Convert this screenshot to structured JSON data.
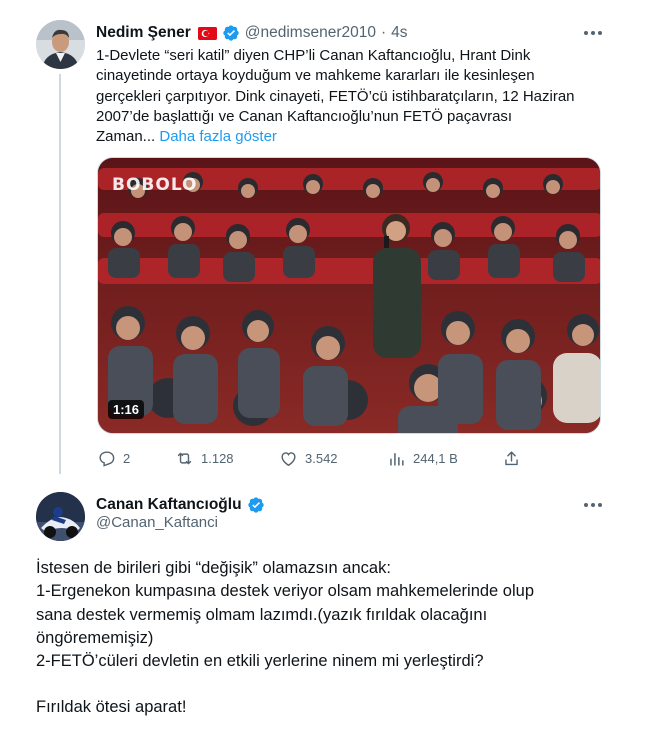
{
  "tweet1": {
    "author_name": "Nedim Şener",
    "handle": "@nedimsener2010",
    "separator": "·",
    "time": "4s",
    "text_lines": [
      "1-Devlete “seri katil” diyen CHP’li Canan Kaftancıoğlu, Hrant Dink",
      "cinayetinde ortaya koyduğum ve mahkeme kararları ile kesinleşen",
      "gerçekleri çarpıtıyor.  Dink cinayeti, FETÖ’cü istihbaratçıların, 12 Haziran",
      "2007’de başlattığı ve Canan Kaftancıoğlu’nun FETÖ paçavrası"
    ],
    "text_last_line": "Zaman...",
    "show_more": "Daha fazla göster",
    "media": {
      "watermark": "BOBOLO",
      "duration": "1:16"
    },
    "actions": {
      "replies": "2",
      "retweets": "1.128",
      "likes": "3.542",
      "views": "244,1 B"
    }
  },
  "tweet2": {
    "author_name": "Canan Kaftancıoğlu",
    "handle": "@Canan_Kaftanci",
    "text_lines": [
      "İstesen de birileri gibi “değişik” olamazsın ancak:",
      "1-Ergenekon kumpasına destek veriyor olsam mahkemelerinde olup",
      "sana destek vermemiş olmam lazımdı.(yazık fırıldak olacağını",
      "öngörememişiz)",
      "2-FETÖ’cüleri devletin en etkili yerlerine ninem mi yerleştirdi?"
    ],
    "closing_line": "Fırıldak ötesi aparat!"
  },
  "colors": {
    "accent": "#1d9bf0",
    "secondary_text": "#536471",
    "flag_red": "#e30a17"
  },
  "icons": [
    "more-icon",
    "verified-badge-icon",
    "turkey-flag-icon",
    "reply-icon",
    "retweet-icon",
    "like-icon",
    "views-icon",
    "share-icon"
  ]
}
